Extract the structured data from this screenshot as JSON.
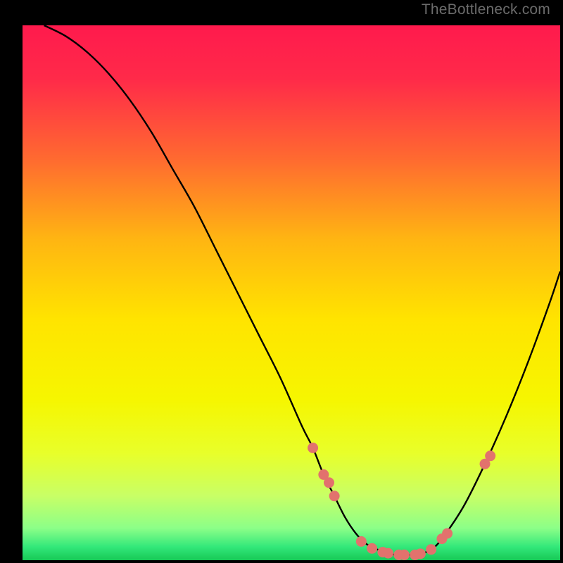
{
  "watermark": "TheBottleneck.com",
  "colors": {
    "bg": "#000000",
    "gradient_stops": [
      {
        "offset": 0.0,
        "color": "#ff1a4d"
      },
      {
        "offset": 0.1,
        "color": "#ff2a49"
      },
      {
        "offset": 0.25,
        "color": "#ff6a30"
      },
      {
        "offset": 0.4,
        "color": "#ffb512"
      },
      {
        "offset": 0.55,
        "color": "#ffe400"
      },
      {
        "offset": 0.7,
        "color": "#f6f600"
      },
      {
        "offset": 0.8,
        "color": "#e8ff2a"
      },
      {
        "offset": 0.88,
        "color": "#c8ff66"
      },
      {
        "offset": 0.94,
        "color": "#8cff88"
      },
      {
        "offset": 0.975,
        "color": "#33e87a"
      },
      {
        "offset": 1.0,
        "color": "#17c956"
      }
    ],
    "curve": "#000000",
    "marker_fill": "#e2726d",
    "marker_stroke": "#b94e4a"
  },
  "chart_data": {
    "type": "line",
    "title": "",
    "xlabel": "",
    "ylabel": "",
    "xlim": [
      0,
      100
    ],
    "ylim": [
      0,
      100
    ],
    "grid": false,
    "series": [
      {
        "name": "bottleneck-curve",
        "x": [
          4,
          8,
          12,
          16,
          20,
          24,
          28,
          32,
          36,
          40,
          44,
          48,
          52,
          54,
          56,
          58,
          60,
          62,
          64,
          66,
          68,
          70,
          72,
          74,
          76,
          78,
          82,
          86,
          90,
          94,
          98,
          100
        ],
        "y": [
          100,
          98,
          95,
          91,
          86,
          80,
          73,
          66,
          58,
          50,
          42,
          34,
          25,
          21,
          16,
          12,
          8,
          5,
          3,
          2,
          1.2,
          1,
          1,
          1.2,
          2,
          4,
          10,
          18,
          27,
          37,
          48,
          54
        ]
      }
    ],
    "markers": {
      "name": "highlight-points",
      "x": [
        54,
        56,
        57,
        58,
        63,
        65,
        67,
        68,
        70,
        71,
        73,
        74,
        76,
        78,
        79,
        86,
        87
      ],
      "y": [
        21,
        16,
        14.5,
        12,
        3.5,
        2.2,
        1.5,
        1.3,
        1,
        1,
        1,
        1.2,
        2,
        4,
        5,
        18,
        19.5
      ]
    }
  }
}
